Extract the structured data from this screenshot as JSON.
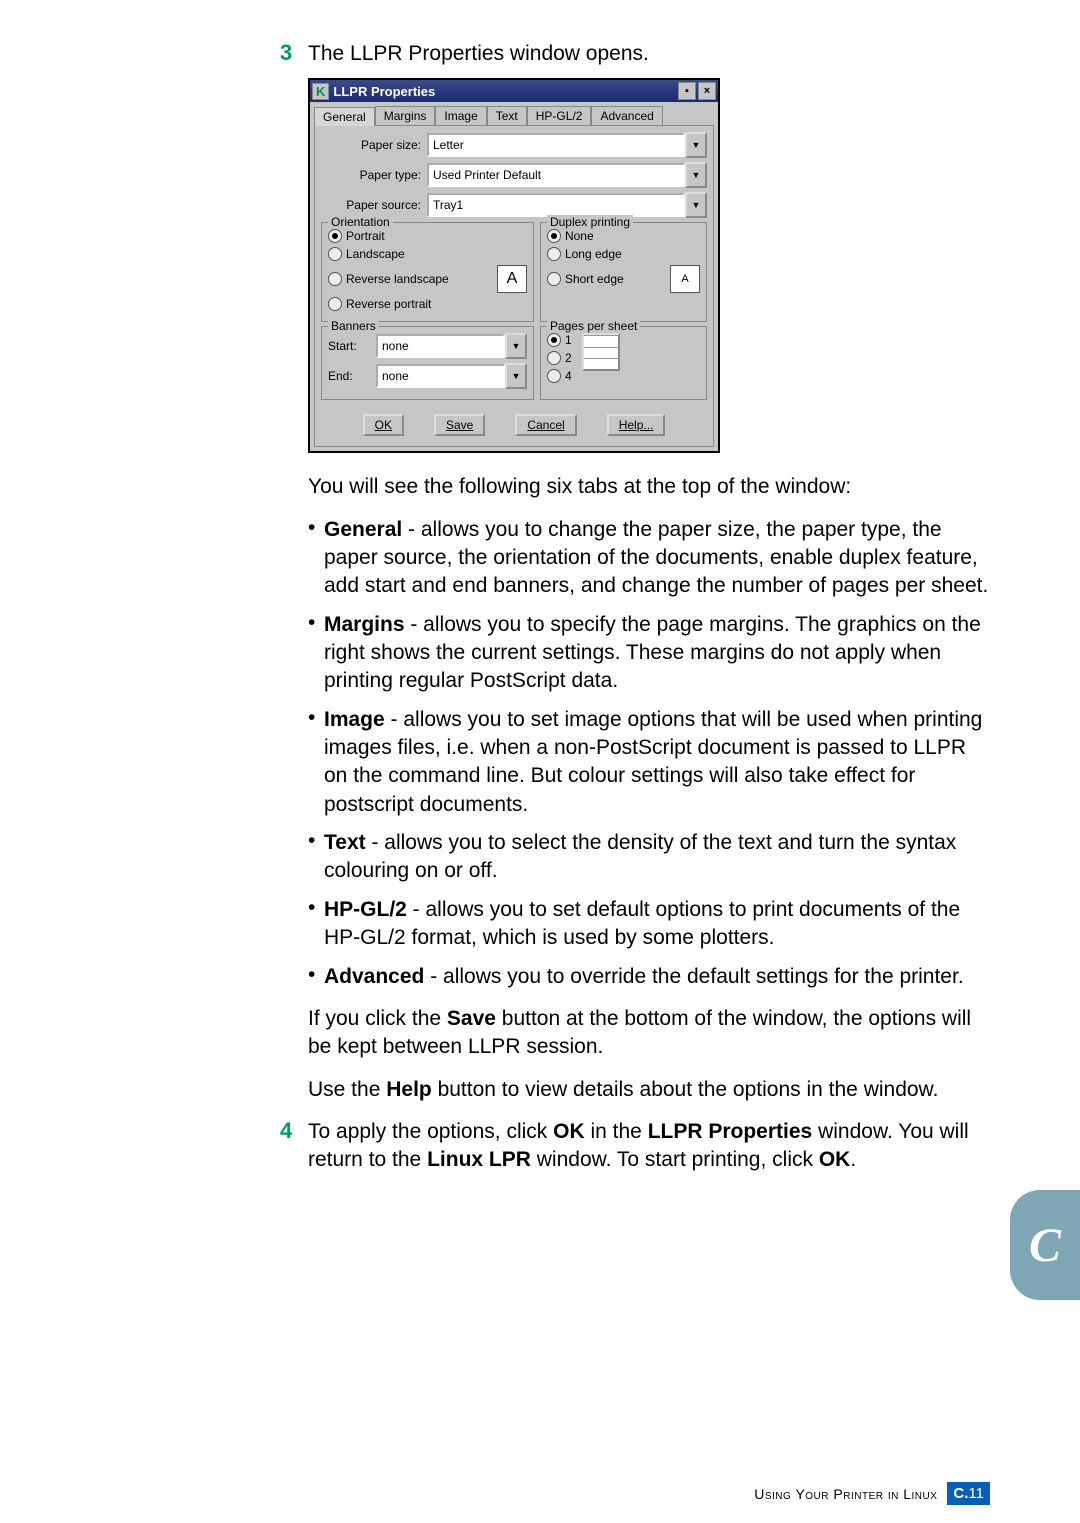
{
  "step3": {
    "num": "3",
    "text": "The LLPR Properties window opens."
  },
  "dialog": {
    "title": "LLPR Properties",
    "tabs": [
      "General",
      "Margins",
      "Image",
      "Text",
      "HP-GL/2",
      "Advanced"
    ],
    "paper_size_label": "Paper size:",
    "paper_size_value": "Letter",
    "paper_type_label": "Paper type:",
    "paper_type_value": "Used Printer Default",
    "paper_source_label": "Paper source:",
    "paper_source_value": "Tray1",
    "orientation": {
      "title": "Orientation",
      "portrait": "Portrait",
      "landscape": "Landscape",
      "reverse_landscape": "Reverse landscape",
      "reverse_portrait": "Reverse portrait"
    },
    "duplex": {
      "title": "Duplex printing",
      "none": "None",
      "long_edge": "Long edge",
      "short_edge": "Short edge"
    },
    "banners": {
      "title": "Banners",
      "start_label": "Start:",
      "start_value": "none",
      "end_label": "End:",
      "end_value": "none"
    },
    "pages": {
      "title": "Pages per sheet",
      "opt1": "1",
      "opt2": "2",
      "opt4": "4"
    },
    "buttons": {
      "ok": "OK",
      "save": "Save",
      "cancel": "Cancel",
      "help": "Help..."
    }
  },
  "intro_after": "You will see the following six tabs at the top of the window:",
  "bullets": {
    "general": {
      "name": "General",
      "desc": " - allows you to change the paper size, the paper type, the paper source, the orientation of the documents, enable duplex feature, add start and end banners, and change the number of pages per sheet."
    },
    "margins": {
      "name": "Margins",
      "desc": " - allows you to specify the page margins. The graphics on the right shows the current settings. These margins do not apply when printing regular PostScript data."
    },
    "image": {
      "name": "Image",
      "desc": " - allows you to set image options that will be used when printing images files, i.e. when a non-PostScript document is passed to LLPR on the command line. But colour settings will also take effect for postscript documents."
    },
    "text": {
      "name": "Text",
      "desc": " - allows you to select the density of the text and turn the syntax colouring on or off."
    },
    "hpgl": {
      "name": "HP-GL/2",
      "desc": " - allows you to set default options to print documents of the HP-GL/2 format, which is used by some plotters."
    },
    "advanced": {
      "name": "Advanced",
      "desc": " - allows you to override the default settings for the printer."
    }
  },
  "save_para": {
    "p1": "If you click the ",
    "b1": "Save",
    "p2": " button at the bottom of the window, the options will be kept between LLPR session."
  },
  "help_para": {
    "p1": "Use the ",
    "b1": "Help",
    "p2": " button to view details about the options in the window."
  },
  "step4": {
    "num": "4",
    "p1": "To apply the options, click ",
    "b1": "OK",
    "p2": " in the ",
    "b2": "LLPR Properties",
    "p3": " window. You will return to the ",
    "b3": "Linux LPR",
    "p4": " window. To start printing, click ",
    "b4": "OK",
    "p5": "."
  },
  "side_tab": "C",
  "footer": {
    "text": "Using Your Printer in Linux",
    "section": "C.",
    "page": "11"
  }
}
